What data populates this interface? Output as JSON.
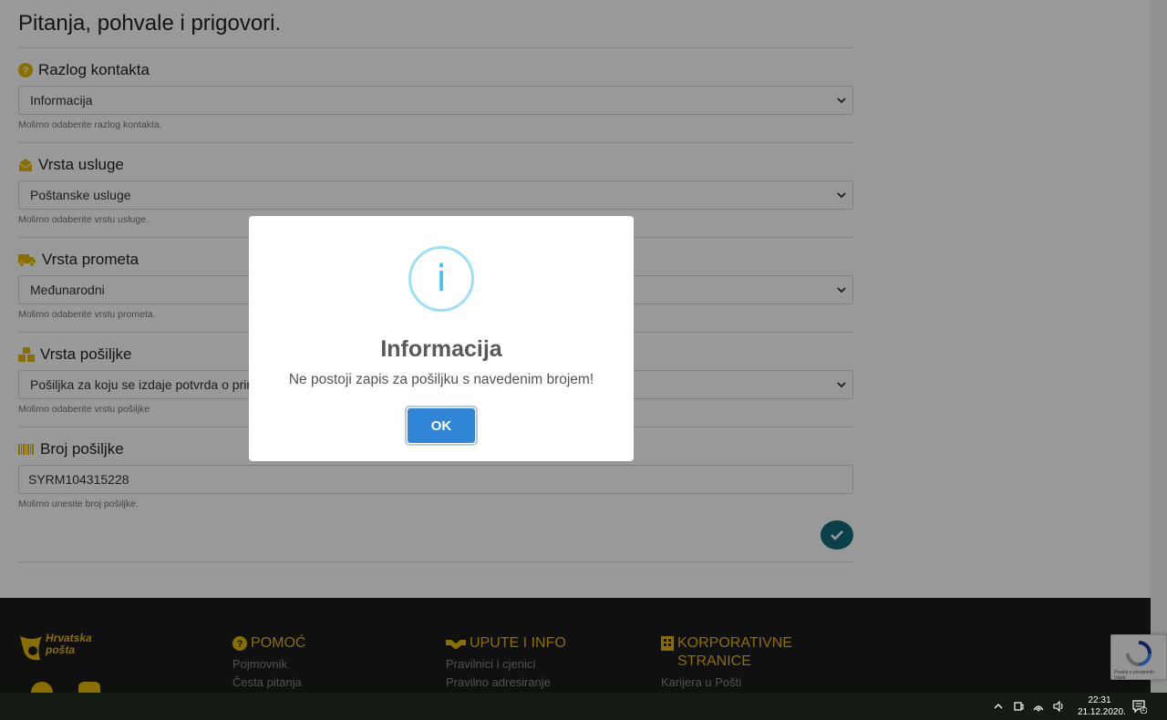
{
  "page": {
    "title": "Pitanja, pohvale i prigovori."
  },
  "form": {
    "contact_reason": {
      "label": "Razlog kontakta",
      "value": "Informacija",
      "help": "Molimo odaberite razlog kontakta."
    },
    "service_type": {
      "label": "Vrsta usluge",
      "value": "Poštanske usluge",
      "help": "Molimo odaberite vrstu usluge."
    },
    "traffic_type": {
      "label": "Vrsta prometa",
      "value": "Međunarodni",
      "help": "Molimo odaberite vrstu prometa."
    },
    "shipment_type": {
      "label": "Vrsta pošiljke",
      "value": "Pošiljka za koju se izdaje potvrda o primit",
      "help": "Molimo odaberite vrstu pošiljke"
    },
    "tracking_number": {
      "label": "Broj pošiljke",
      "value": "SYRM104315228",
      "help": "Molimo unesite broj pošiljke."
    }
  },
  "footer": {
    "logo_line1": "Hrvatska",
    "logo_line2": "pošta",
    "help": {
      "heading": "POMOĆ",
      "links": [
        "Pojmovnik",
        "Česta pitanja"
      ]
    },
    "info": {
      "heading": "UPUTE I INFO",
      "links": [
        "Pravilnici i cjenici",
        "Pravilno adresiranje"
      ]
    },
    "corporate": {
      "heading_line1": "KORPORATIVNE",
      "heading_line2": "STRANICE",
      "links": [
        "Karijera u Pošti"
      ]
    }
  },
  "recaptcha": {
    "text": "Pravila o privatnosti - Uvjeti"
  },
  "modal": {
    "icon": "i",
    "title": "Informacija",
    "message": "Ne postoji zapis za pošiljku s navedenim brojem!",
    "ok_label": "OK"
  },
  "taskbar": {
    "time": "22:31",
    "date": "21.12.2020.",
    "notification_count": "1"
  },
  "colors": {
    "accent_yellow": "#e5b800",
    "submit_teal": "#136a7a",
    "modal_button": "#3085d6",
    "info_icon": "#3fc3ee"
  }
}
